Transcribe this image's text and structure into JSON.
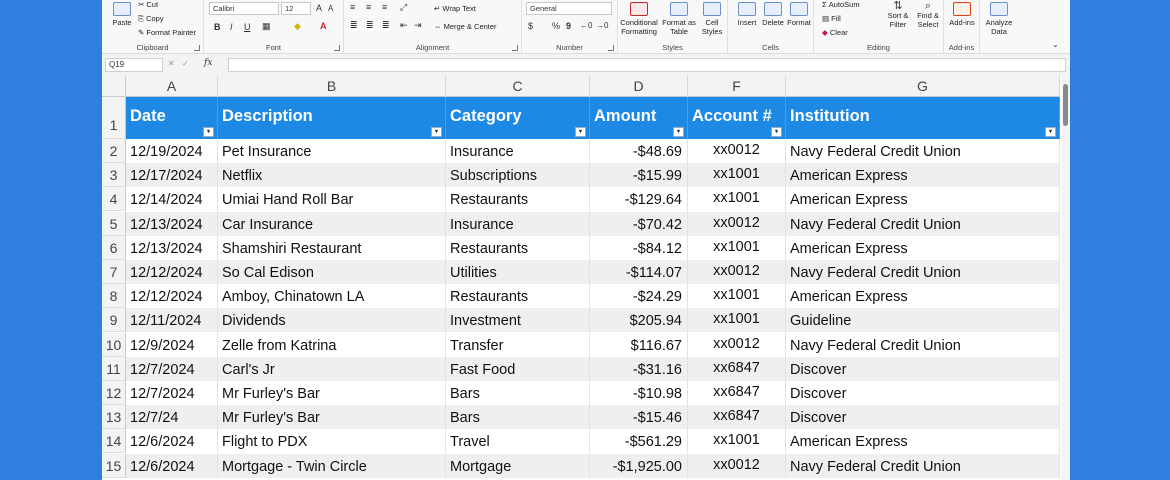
{
  "ribbon": {
    "clipboard": {
      "label": "Clipboard",
      "paste": "Paste",
      "cut": "Cut",
      "copy": "Copy",
      "format_painter": "Format Painter"
    },
    "font": {
      "label": "Font",
      "font_name": "Calibri",
      "font_size": "12",
      "increase": "A",
      "decrease": "A",
      "bold": "B",
      "italic": "I",
      "underline": "U"
    },
    "alignment": {
      "label": "Alignment",
      "wrap_text": "Wrap Text",
      "merge_center": "Merge & Center"
    },
    "number": {
      "label": "Number",
      "format": "General",
      "currency": "$",
      "percent": "%",
      "comma": "9"
    },
    "styles": {
      "label": "Styles",
      "conditional": "Conditional Formatting",
      "format_table": "Format as Table",
      "cell_styles": "Cell Styles"
    },
    "cells": {
      "label": "Cells",
      "insert": "Insert",
      "delete": "Delete",
      "format": "Format"
    },
    "editing": {
      "label": "Editing",
      "autosum": "AutoSum",
      "fill": "Fill",
      "clear": "Clear",
      "sort_filter": "Sort & Filter",
      "find_select": "Find & Select"
    },
    "addins": {
      "label": "Add-ins",
      "addins_btn": "Add-ins"
    },
    "analyze": {
      "label": "Analyze Data"
    }
  },
  "formula_bar": {
    "name_box": "Q19",
    "fx": "fx",
    "value": ""
  },
  "columns": [
    "A",
    "B",
    "C",
    "D",
    "F",
    "G"
  ],
  "headers": [
    "Date",
    "Description",
    "Category",
    "Amount",
    "Account #",
    "Institution"
  ],
  "row_numbers": [
    "1",
    "2",
    "3",
    "4",
    "5",
    "6",
    "7",
    "8",
    "9",
    "10",
    "11",
    "12",
    "13",
    "14",
    "15"
  ],
  "rows": [
    [
      "12/19/2024",
      "Pet Insurance",
      "Insurance",
      "-$48.69",
      "xx0012",
      "Navy Federal Credit Union"
    ],
    [
      "12/17/2024",
      "Netflix",
      "Subscriptions",
      "-$15.99",
      "xx1001",
      "American Express"
    ],
    [
      "12/14/2024",
      "Umiai Hand Roll Bar",
      "Restaurants",
      "-$129.64",
      "xx1001",
      "American Express"
    ],
    [
      "12/13/2024",
      "Car Insurance",
      "Insurance",
      "-$70.42",
      "xx0012",
      "Navy Federal Credit Union"
    ],
    [
      "12/13/2024",
      "Shamshiri Restaurant",
      "Restaurants",
      "-$84.12",
      "xx1001",
      "American Express"
    ],
    [
      "12/12/2024",
      "So Cal Edison",
      "Utilities",
      "-$114.07",
      "xx0012",
      "Navy Federal Credit Union"
    ],
    [
      "12/12/2024",
      "Amboy, Chinatown LA",
      "Restaurants",
      "-$24.29",
      "xx1001",
      "American Express"
    ],
    [
      "12/11/2024",
      "Dividends",
      "Investment",
      "$205.94",
      "xx1001",
      "Guideline"
    ],
    [
      "12/9/2024",
      "Zelle from Katrina",
      "Transfer",
      "$116.67",
      "xx0012",
      "Navy Federal Credit Union"
    ],
    [
      "12/7/2024",
      "Carl's Jr",
      "Fast Food",
      "-$31.16",
      "xx6847",
      "Discover"
    ],
    [
      "12/7/2024",
      "Mr Furley's Bar",
      "Bars",
      "-$10.98",
      "xx6847",
      "Discover"
    ],
    [
      "12/7/24",
      "Mr Furley's Bar",
      "Bars",
      "-$15.46",
      "xx6847",
      "Discover"
    ],
    [
      "12/6/2024",
      "Flight to PDX",
      "Travel",
      "-$561.29",
      "xx1001",
      "American Express"
    ],
    [
      "12/6/2024",
      "Mortgage - Twin Circle",
      "Mortgage",
      "-$1,925.00",
      "xx0012",
      "Navy Federal Credit Union"
    ]
  ],
  "colors": {
    "background": "#2f80de",
    "header_fill": "#1e88e5",
    "band": "#efefef"
  }
}
